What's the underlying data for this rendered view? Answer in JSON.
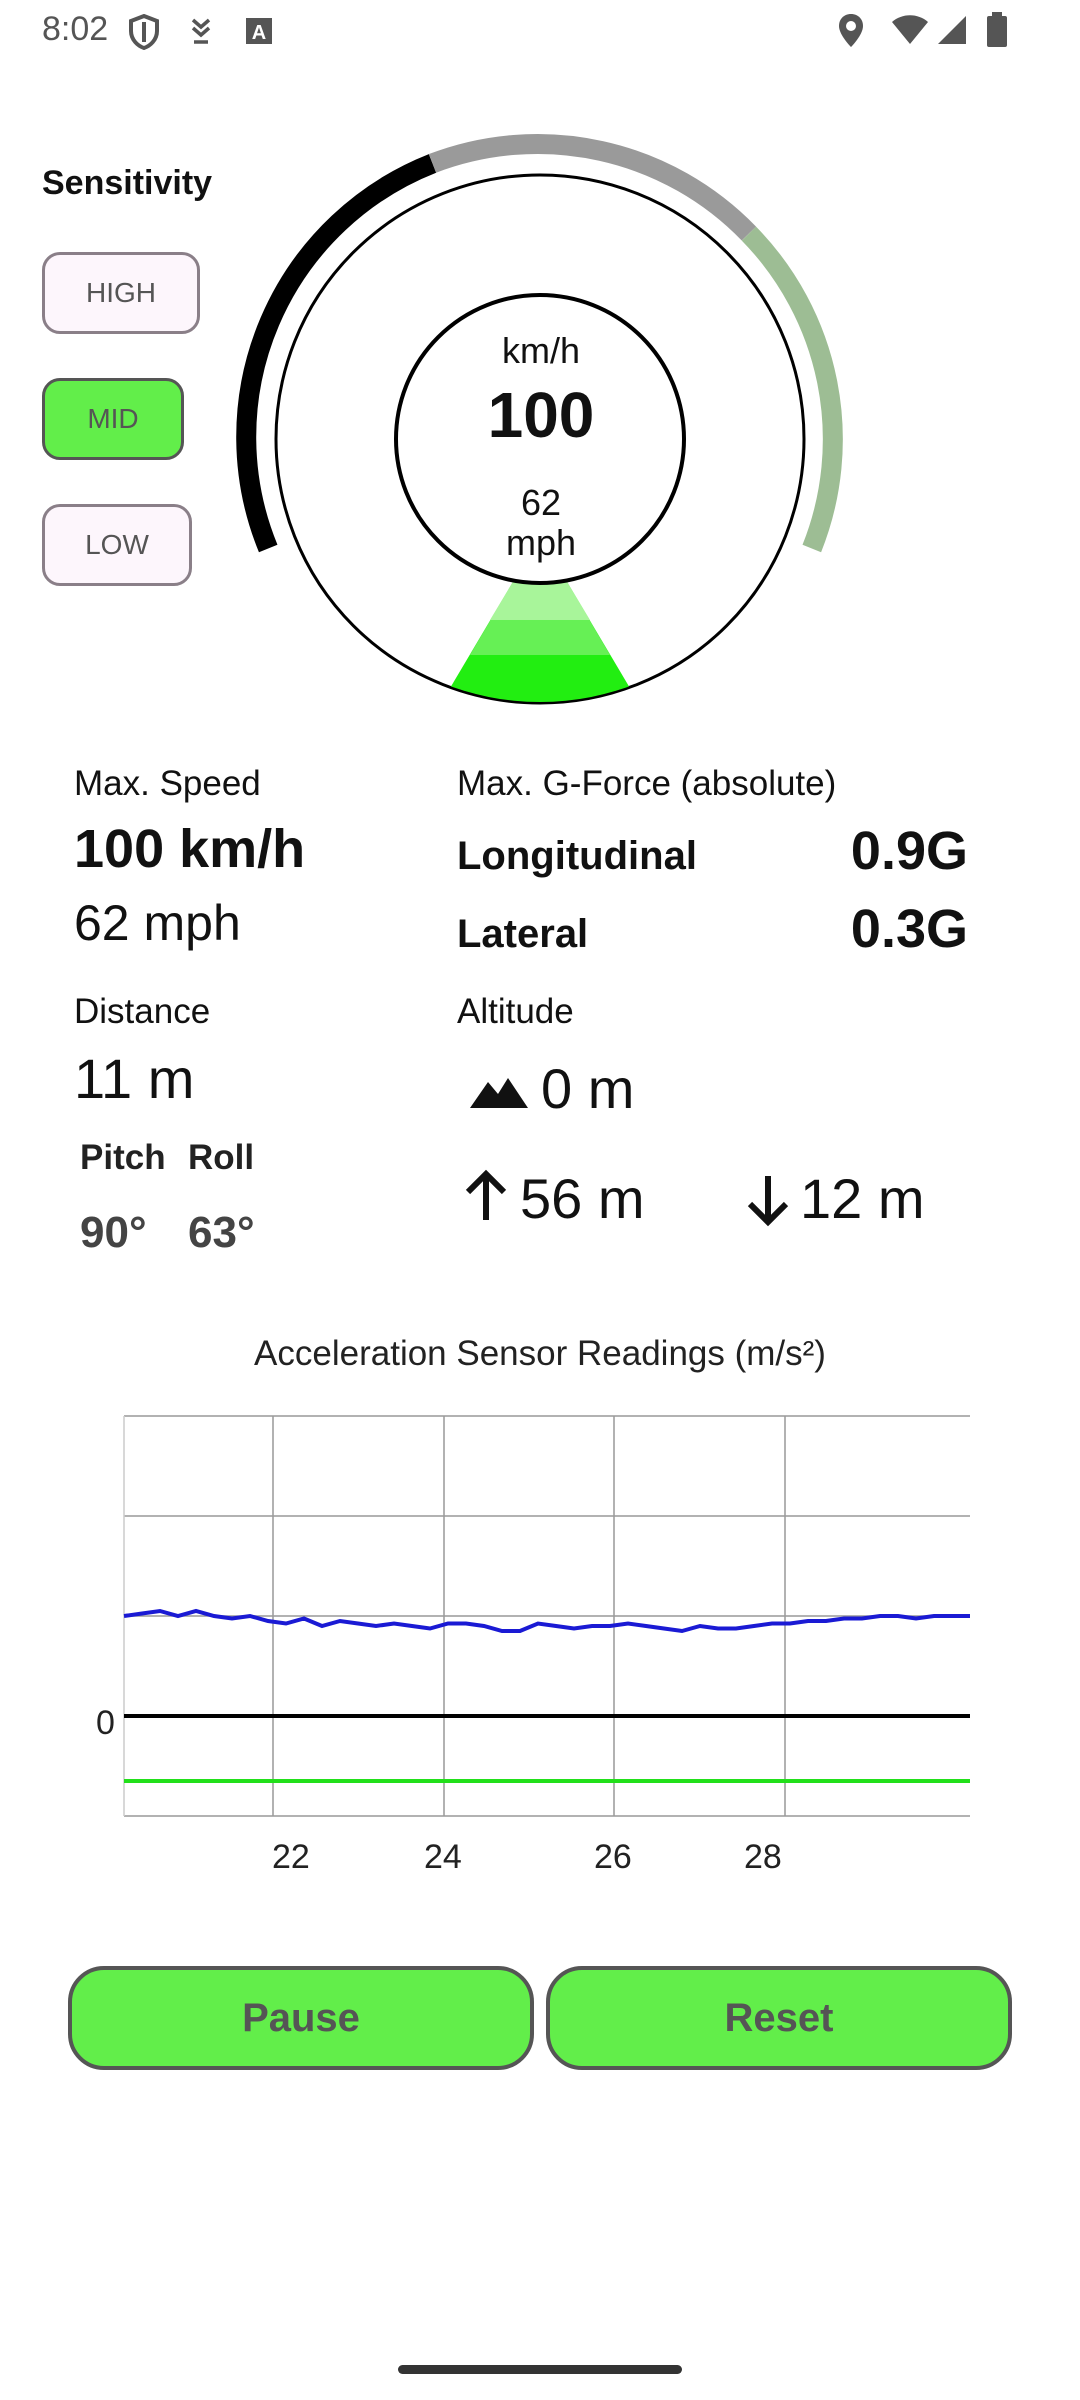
{
  "status_bar": {
    "time": "8:02",
    "left_icons": [
      "shield-icon",
      "download-icon",
      "font-icon"
    ],
    "right_icons": [
      "location-icon",
      "wifi-icon",
      "signal-icon",
      "battery-icon"
    ]
  },
  "sensitivity": {
    "title": "Sensitivity",
    "options": [
      {
        "label": "HIGH",
        "active": false
      },
      {
        "label": "MID",
        "active": true
      },
      {
        "label": "LOW",
        "active": false
      }
    ]
  },
  "gauge": {
    "unit_primary": "km/h",
    "speed_kmh": "100",
    "speed_mph": "62",
    "unit_secondary": "mph",
    "colors": {
      "arc_low": "#000000",
      "arc_mid": "#9a9a9a",
      "arc_high": "#9dbd94",
      "fill": "#22ee11"
    }
  },
  "stats": {
    "max_speed": {
      "label": "Max. Speed",
      "kmh": "100 km/h",
      "mph": "62 mph"
    },
    "g_force": {
      "label": "Max. G-Force (absolute)",
      "longitudinal_label": "Longitudinal",
      "longitudinal_value": "0.9G",
      "lateral_label": "Lateral",
      "lateral_value": "0.3G"
    },
    "distance": {
      "label": "Distance",
      "value": "11 m"
    },
    "altitude": {
      "label": "Altitude",
      "value": "0 m",
      "ascent": "56 m",
      "descent": "12 m"
    },
    "pitch": {
      "label": "Pitch",
      "value": "90°"
    },
    "roll": {
      "label": "Roll",
      "value": "63°"
    }
  },
  "chart_data": {
    "type": "line",
    "title": "Acceleration Sensor Readings (m/s²)",
    "x_ticks": [
      "22",
      "24",
      "26",
      "28"
    ],
    "y_ticks": [
      "0"
    ],
    "grid": true,
    "series": [
      {
        "color": "#1a1ad4",
        "values": [
          2.0,
          2.05,
          2.1,
          2.0,
          2.1,
          2.0,
          1.95,
          2.0,
          1.9,
          1.85,
          1.95,
          1.8,
          1.9,
          1.85,
          1.8,
          1.85,
          1.8,
          1.75,
          1.85,
          1.85,
          1.8,
          1.7,
          1.7,
          1.85,
          1.8,
          1.75,
          1.8,
          1.8,
          1.85,
          1.8,
          1.75,
          1.7,
          1.8,
          1.75,
          1.75,
          1.8,
          1.85,
          1.85,
          1.9,
          1.9,
          1.95,
          1.95,
          2.0,
          2.0,
          1.95,
          2.0,
          2.0,
          2.0
        ]
      },
      {
        "color": "#000000",
        "values": [
          0,
          0
        ]
      },
      {
        "color": "#22e01a",
        "values": [
          -1.3,
          -1.3
        ]
      }
    ],
    "ylim": [
      -2,
      6
    ]
  },
  "actions": {
    "pause": "Pause",
    "reset": "Reset"
  }
}
